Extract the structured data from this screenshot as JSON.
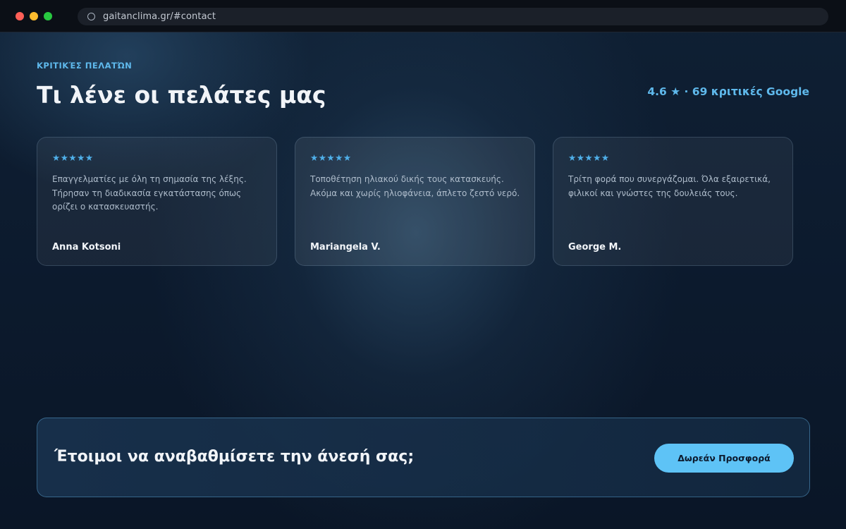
{
  "browser": {
    "url": "gaitanclima.gr/#contact"
  },
  "section": {
    "eyebrow": "ΚΡΙΤΙΚΈΣ ΠΕΛΑΤΏΝ",
    "heading": "Τι λένε οι πελάτες μας",
    "rating_summary": "4.6 ★ · 69 κριτικές Google"
  },
  "reviews": [
    {
      "stars": "★★★★★",
      "text": "Επαγγελματίες με όλη τη σημασία της λέξης. Τήρησαν τη διαδικασία εγκατάστασης όπως ορίζει ο κατασκευαστής.",
      "author": "Anna Kotsoni"
    },
    {
      "stars": "★★★★★",
      "text": "Τοποθέτηση ηλιακού δικής τους κατασκευής. Ακόμα και χωρίς ηλιοφάνεια, άπλετο ζεστό νερό.",
      "author": "Mariangela V."
    },
    {
      "stars": "★★★★★",
      "text": "Τρίτη φορά που συνεργάζομαι. Όλα εξαιρετικά, φιλικοί και γνώστες της δουλειάς τους.",
      "author": "George M."
    }
  ],
  "cta": {
    "title": "Έτοιμοι να αναβαθμίσετε την άνεσή σας;",
    "button_label": "Δωρεάν Προσφορά"
  },
  "colors": {
    "accent": "#5ec3f6",
    "background": "#0c1a2d"
  }
}
